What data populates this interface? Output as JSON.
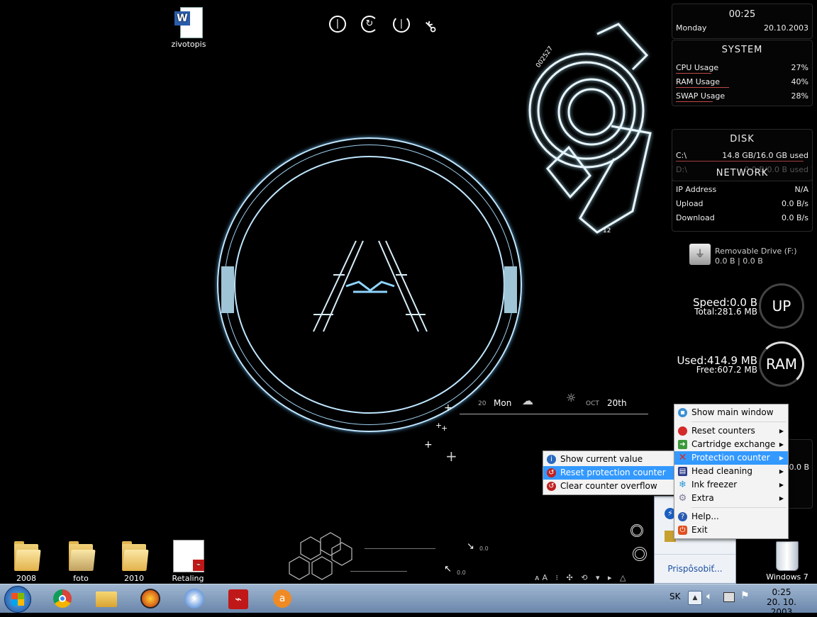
{
  "desktop": {
    "icons": [
      {
        "label": "zivotopis"
      },
      {
        "label": "2008"
      },
      {
        "label": "foto"
      },
      {
        "label": "2010"
      },
      {
        "label": "Retaling"
      }
    ],
    "recycle_bin_label": "Windows 7"
  },
  "clock_widget": {
    "time": "00:25",
    "day": "Monday",
    "date": "20.10.2003"
  },
  "system_panel": {
    "title": "SYSTEM",
    "rows": [
      {
        "label": "CPU Usage",
        "value": "27%",
        "level": 0.27
      },
      {
        "label": "RAM Usage",
        "value": "40%",
        "level": 0.4
      },
      {
        "label": "SWAP Usage",
        "value": "28%",
        "level": 0.28
      }
    ]
  },
  "disk_panel": {
    "title": "DISK",
    "rows": [
      {
        "label": "C:\\",
        "value": "14.8 GB/16.0 GB used"
      },
      {
        "label": "D:\\",
        "value": "0.0 B/0.0 B used"
      }
    ]
  },
  "network_panel": {
    "title": "NETWORK",
    "rows": [
      {
        "label": "IP Address",
        "value": "N/A"
      },
      {
        "label": "Upload",
        "value": "0.0 B/s"
      },
      {
        "label": "Download",
        "value": "0.0 B/s"
      }
    ]
  },
  "removable_drive": {
    "name": "Removable Drive (F:)",
    "stats": "0.0 B |  0.0 B"
  },
  "up_gauge": {
    "speed": "Speed:0.0 B",
    "total": "Total:281.6 MB",
    "label": "UP"
  },
  "ram_gauge": {
    "used": "Used:414.9 MB",
    "free": "Free:607.2 MB",
    "label": "RAM"
  },
  "hud": {
    "day_num": "20",
    "day_name": "Mon",
    "month": "OCT",
    "date_text": "20th",
    "big_logo": "12",
    "sticker": "002527",
    "small_value_1": "0.0",
    "small_value_2": "0.0"
  },
  "main_menu": {
    "items": [
      {
        "label": "Show main window",
        "color": "#3a8fd6"
      },
      {
        "label": "Reset counters",
        "color": "#d42a2a",
        "submenu": true
      },
      {
        "label": "Cartridge exchange",
        "color": "#3a9a3a",
        "submenu": true
      },
      {
        "label": "Protection counter",
        "color": "#d42a2a",
        "submenu": true,
        "highlight": true
      },
      {
        "label": "Head cleaning",
        "color": "#2a3a8a",
        "submenu": true
      },
      {
        "label": "Ink freezer",
        "color": "#2a9ad6",
        "submenu": true
      },
      {
        "label": "Extra",
        "color": "#7a7a9a",
        "submenu": true
      },
      {
        "label": "Help...",
        "color": "#2a5ab0"
      },
      {
        "label": "Exit",
        "color": "#e05020"
      }
    ]
  },
  "sub_menu": {
    "items": [
      {
        "label": "Show current value",
        "color": "#2a6ac0"
      },
      {
        "label": "Reset protection counter",
        "color": "#c02020",
        "highlight": true
      },
      {
        "label": "Clear counter overflow",
        "color": "#c02020"
      }
    ]
  },
  "tray_popup": {
    "customize_link": "Prispôsobiť..."
  },
  "behind_panel": {
    "value": "0.0 B"
  },
  "taskbar": {
    "language": "SK",
    "time": "0:25",
    "date": "20. 10. 2003",
    "apps": [
      "chrome-icon",
      "explorer-icon",
      "burner-icon",
      "download-icon",
      "acrobat-icon",
      "avast-icon"
    ]
  },
  "colors": {
    "taskbar": "#7f9bbf",
    "menu_highlight": "#3399ff",
    "hud_glow": "#bfe6ff"
  }
}
